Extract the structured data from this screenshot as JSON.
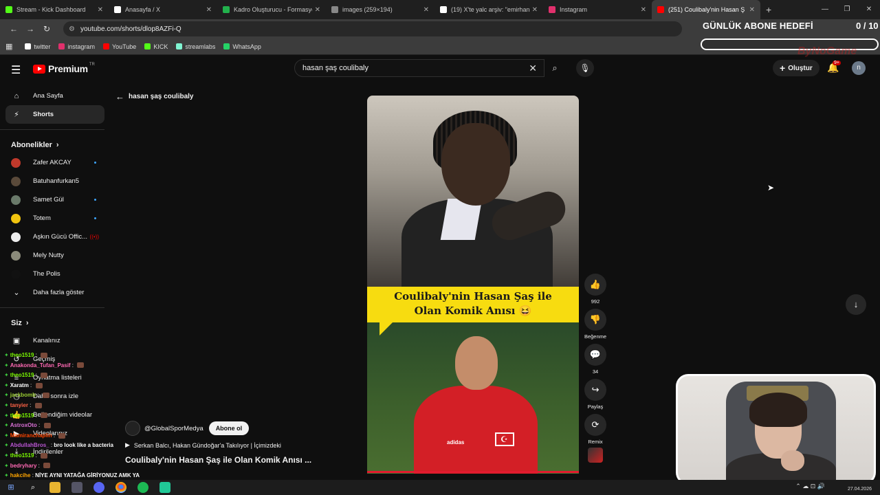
{
  "browser": {
    "tabs": [
      {
        "title": "Stream - Kick Dashboard",
        "color": "#53fc18"
      },
      {
        "title": "Anasayfa / X",
        "color": "#ffffff"
      },
      {
        "title": "Kadro Oluşturucu - Formasyon",
        "color": "#22b14c"
      },
      {
        "title": "images (259×194)",
        "color": "#888888"
      },
      {
        "title": "(19) X'te yalc arşiv: \"emirhan de",
        "color": "#ffffff"
      },
      {
        "title": "Instagram",
        "color": "#e1306c"
      },
      {
        "title": "(251) Coulibaly'nin Hasan Ş",
        "color": "#ff0000"
      }
    ],
    "url": "youtube.com/shorts/dlop8AZFi-Q",
    "bookmarks": [
      {
        "label": "twitter",
        "color": "#ffffff"
      },
      {
        "label": "instagram",
        "color": "#e1306c"
      },
      {
        "label": "YouTube",
        "color": "#ff0000"
      },
      {
        "label": "KICK",
        "color": "#53fc18"
      },
      {
        "label": "streamlabs",
        "color": "#80f5d2"
      },
      {
        "label": "WhatsApp",
        "color": "#25d366"
      }
    ]
  },
  "overlay": {
    "goal_title": "GÜNLÜK ABONE HEDEFİ",
    "goal_count": "0 / 10",
    "logo_text": "ByNoGame"
  },
  "youtube": {
    "logo": "Premium",
    "country": "TR",
    "search_value": "hasan şaş coulibaly",
    "create_label": "Oluştur",
    "notif_badge": "9+",
    "avatar_letter": "n",
    "back_label": "hasan şaş coulibaly"
  },
  "sidebar": {
    "main": [
      {
        "label": "Ana Sayfa",
        "icon": "home-icon"
      },
      {
        "label": "Shorts",
        "icon": "shorts-icon"
      }
    ],
    "subs_heading": "Abonelikler",
    "subs": [
      {
        "label": "Zafer AKCAY",
        "color": "#c0392b",
        "new": true
      },
      {
        "label": "Batuhanfurkan5",
        "color": "#5a4a3a",
        "new": false
      },
      {
        "label": "Samet Gül",
        "color": "#6a7a6a",
        "new": true
      },
      {
        "label": "Totem",
        "color": "#f1c40f",
        "new": true
      },
      {
        "label": "Aşkın Gücü Offic...",
        "color": "#eeeeee",
        "live": true
      },
      {
        "label": "Mely Nutty",
        "color": "#8a8a7a",
        "new": false
      },
      {
        "label": "The Polis",
        "color": "#111111",
        "new": false
      }
    ],
    "more_label": "Daha fazla göster",
    "you_heading": "Siz",
    "you_items": [
      {
        "label": "Kanalınız"
      },
      {
        "label": "Geçmiş"
      },
      {
        "label": "Oynatma listeleri"
      },
      {
        "label": "Daha sonra izle"
      },
      {
        "label": "Beğendiğim videolar"
      },
      {
        "label": "Videolarınız"
      },
      {
        "label": "İndirilenler"
      }
    ]
  },
  "short": {
    "banner_line1": "Coulibaly'nin Hasan Şaş ile",
    "banner_line2": "Olan Komik Anısı 😆",
    "channel": "@GlobalSporMedya",
    "subscribe_label": "Abone ol",
    "music": "Serkan Balcı, Hakan Gündoğar'a Takılıyor | İçimizdeki",
    "title": "Coulibaly'nin Hasan Şaş ile Olan Komik Anısı ...",
    "likes": "992",
    "dislike_label": "Beğenme",
    "comments": "34",
    "share_label": "Paylaş",
    "remix_label": "Remix"
  },
  "chat": [
    {
      "user": "theo1519",
      "msg": "",
      "color": "#7cfc00"
    },
    {
      "user": "Anakonda_Tufan_Pasif",
      "msg": "",
      "color": "#ff69b4"
    },
    {
      "user": "theo1519",
      "msg": "",
      "color": "#7cfc00"
    },
    {
      "user": "Xaratm",
      "msg": "",
      "color": "#ffffff"
    },
    {
      "user": "jackbomb",
      "msg": "",
      "color": "#9acd32"
    },
    {
      "user": "tanyier",
      "msg": "",
      "color": "#ff6347"
    },
    {
      "user": "theo1519",
      "msg": "",
      "color": "#7cfc00"
    },
    {
      "user": "AstroxOto",
      "msg": "",
      "color": "#da70d6"
    },
    {
      "user": "Mamiranchaplin",
      "msg": "",
      "color": "#ff4500"
    },
    {
      "user": "AbdullahBros_",
      "msg": "bro look like a bacteria",
      "color": "#ba55d3"
    },
    {
      "user": "theo1519",
      "msg": "",
      "color": "#7cfc00"
    },
    {
      "user": "bedryhary",
      "msg": "",
      "color": "#ff69b4"
    },
    {
      "user": "hakcihe",
      "msg": "NİYE AYNI YATAĞA GİRİYONUZ AMK YA",
      "color": "#ffa500"
    }
  ],
  "taskbar": {
    "date": "27.04.2026"
  }
}
